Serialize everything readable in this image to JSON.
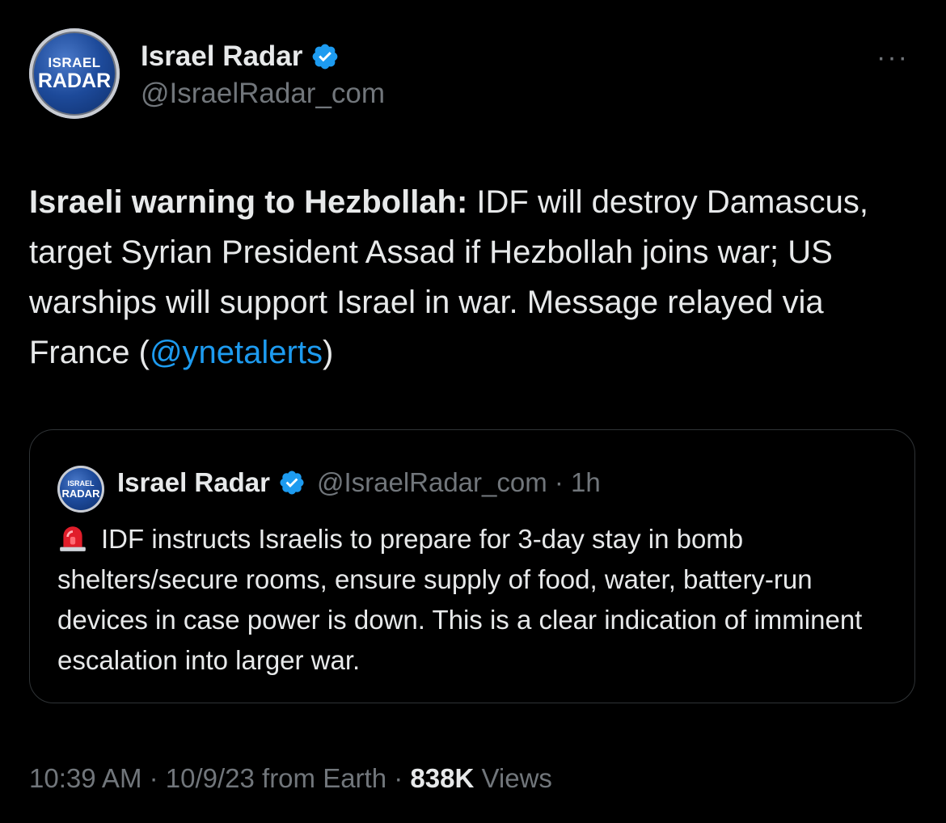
{
  "author": {
    "display_name": "Israel Radar",
    "handle": "@IsraelRadar_com",
    "avatar_text": [
      "ISRAEL",
      "RADAR"
    ],
    "verified": true
  },
  "tweet": {
    "lead": "Israeli warning to Hezbollah:",
    "body": " IDF will destroy Damascus, target Syrian President Assad if Hezbollah joins war; US warships will support Israel in war. Message relayed via France (",
    "mention": "@ynetalerts",
    "tail": ")"
  },
  "quoted_tweet": {
    "display_name": "Israel Radar",
    "handle_time": "@IsraelRadar_com · 1h",
    "avatar_text": [
      "ISRAEL",
      "RADAR"
    ],
    "icon": "police-siren-icon",
    "text": "IDF instructs Israelis to prepare for 3-day stay in bomb shelters/secure rooms, ensure supply of food, water, battery-run devices in case power is down. This is a clear indication of imminent escalation into larger war."
  },
  "meta": {
    "time_date_source": "10:39 AM · 10/9/23 from Earth · ",
    "views_count": "838K",
    "views_label": " Views"
  },
  "more_label": "···",
  "colors": {
    "background": "#000000",
    "text": "#e7e9ea",
    "muted": "#71767b",
    "link": "#1d9bf0",
    "verified": "#1d9bf0",
    "border": "#2f3336"
  }
}
